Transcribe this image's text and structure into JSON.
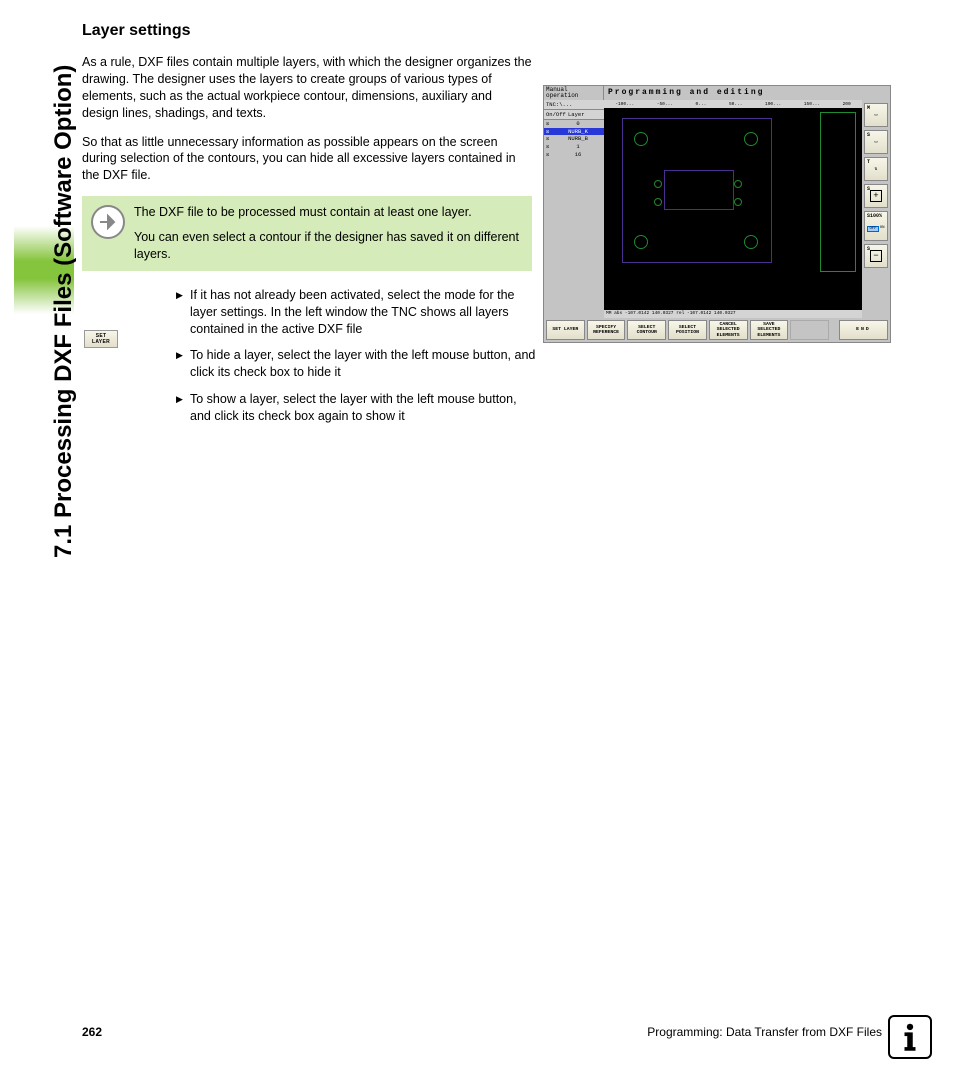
{
  "sidebar_title": "7.1 Processing DXF Files (Software Option)",
  "heading": "Layer settings",
  "para1": "As a rule, DXF files contain multiple layers, with which the designer organizes the drawing. The designer uses the layers to create groups of various types of elements, such as the actual workpiece contour, dimensions, auxiliary and design lines, shadings, and texts.",
  "para2": "So that as little unnecessary information as possible appears on the screen during selection of the contours, you can hide all excessive layers contained in the DXF file.",
  "note": {
    "line1": "The DXF file to be processed must contain at least one layer.",
    "line2": "You can even select a contour if the designer has saved it on different layers."
  },
  "set_layer_button": "SET\nLAYER",
  "bullets": [
    "If it has not already been activated, select the mode for the layer settings. In the left window the TNC shows all layers contained in the active DXF file",
    "To hide a layer, select the layer with the left mouse button, and click its check box to hide it",
    "To show a layer, select the layer with the left mouse button, and click its check box again to show it"
  ],
  "screenshot": {
    "mode": "Manual operation",
    "title": "Programming and editing",
    "tnc": "TNC:\\...",
    "layer_header": {
      "col1": "On/Off",
      "col2": "Layer"
    },
    "layers": [
      {
        "checked": true,
        "name": "0"
      },
      {
        "checked": true,
        "name": "NURB_K",
        "selected": true
      },
      {
        "checked": true,
        "name": "NURB_B"
      },
      {
        "checked": true,
        "name": "1"
      },
      {
        "checked": true,
        "name": "16"
      }
    ],
    "ruler": [
      "-100...",
      "-50...",
      "0...",
      "50...",
      "100...",
      "150...",
      "200"
    ],
    "status": "MM   abs -107.0142 140.0327 rel -107.0142 140.0327",
    "softkeys": [
      "SET LAYER",
      "SPECIFY REFERENCE",
      "SELECT CONTOUR",
      "SELECT POSITION",
      "CANCEL SELECTED ELEMENTS",
      "SAVE SELECTED ELEMENTS",
      "",
      "END"
    ],
    "vkeys": {
      "m": "M",
      "s": "S",
      "t": "T",
      "sp": "S",
      "s100": "S100%",
      "off": "OFF",
      "on": "ON",
      "sm": "S"
    }
  },
  "footer": {
    "page": "262",
    "chapter": "Programming: Data Transfer from DXF Files"
  }
}
